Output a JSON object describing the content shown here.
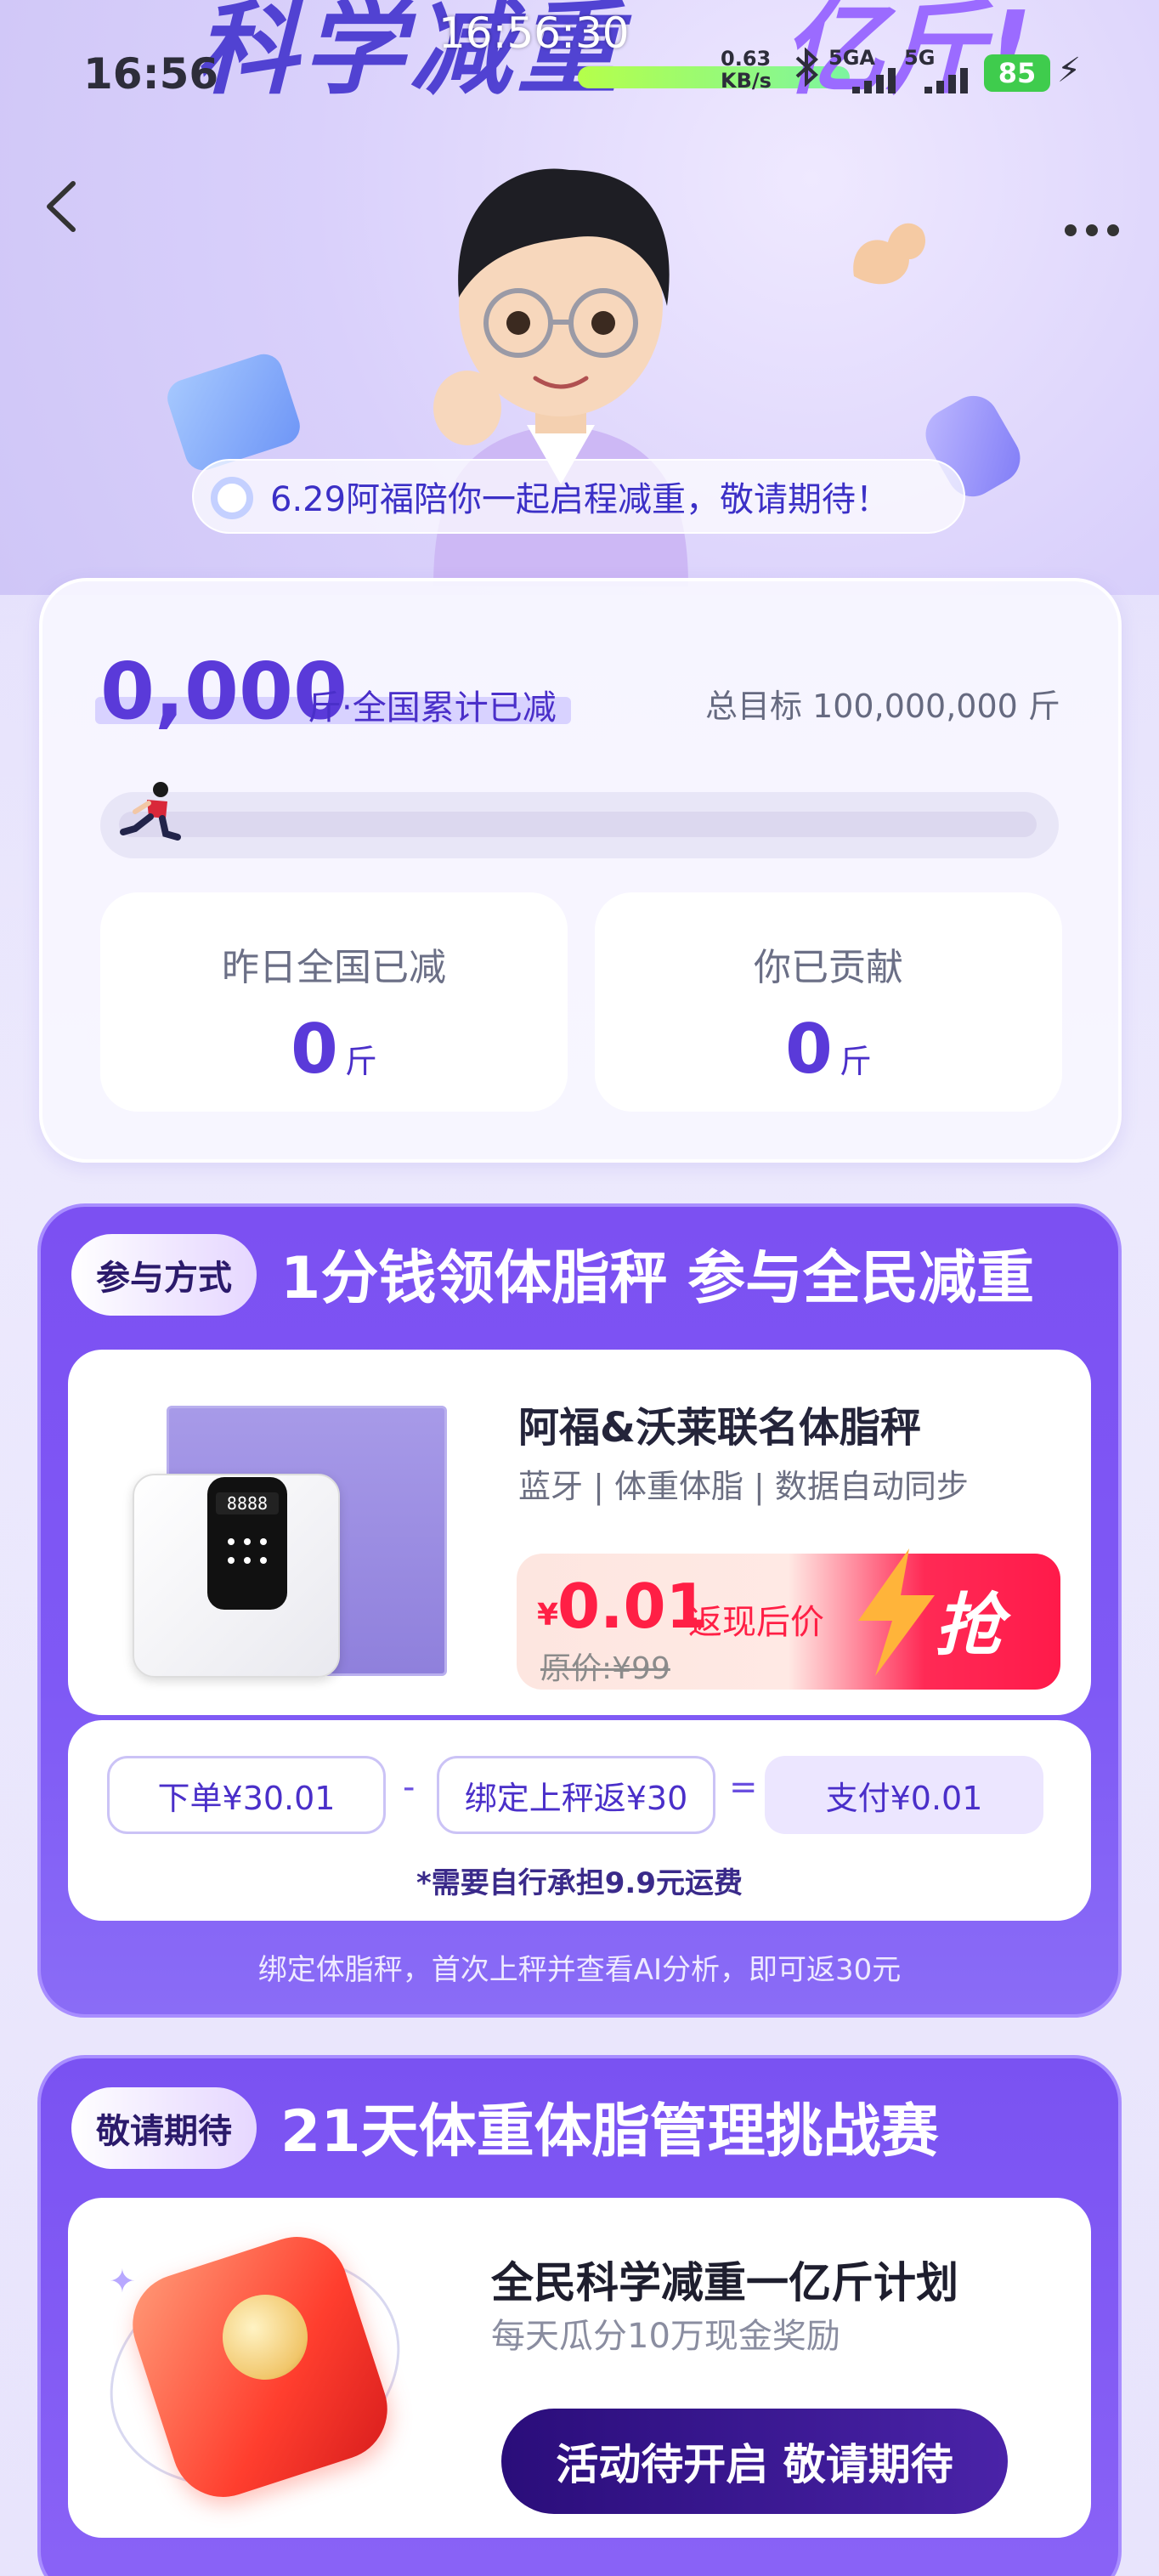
{
  "status_bar": {
    "time": "16:56",
    "clock_overlay": "16:56:30",
    "net_speed_value": "0.63",
    "net_speed_unit": "KB/s",
    "net_type_1": "5GA",
    "net_type_2": "5G",
    "battery": "85"
  },
  "hero": {
    "title_part1": "科学减重",
    "title_part2": "亿斤!",
    "notice": "6.29阿福陪你一起启程减重，敬请期待！"
  },
  "stats": {
    "total": "0,000",
    "total_unit": "斤·全国累计已减",
    "goal_label": "总目标 100,000,000 斤",
    "progress": 0,
    "yesterday_label": "昨日全国已减",
    "yesterday_value": "0",
    "contrib_label": "你已贡献",
    "contrib_value": "0",
    "unit": "斤"
  },
  "join": {
    "tag": "参与方式",
    "title": "1分钱领体脂秤 参与全民减重",
    "product_name": "阿福&沃莱联名体脂秤",
    "product_desc": "蓝牙 | 体重体脂 | 数据自动同步",
    "price_symbol": "¥",
    "price": "0.01",
    "price_note": "返现后价",
    "original_price": "原价:¥99",
    "grab_label": "抢",
    "formula": {
      "order": "下单¥30.01",
      "minus": "-",
      "bind": "绑定上秤返¥30",
      "equals": "=",
      "pay": "支付¥0.01"
    },
    "shipping_note": "*需要自行承担9.9元运费",
    "rebate_note": "绑定体脂秤，首次上秤并查看AI分析，即可返30元"
  },
  "challenge": {
    "tag": "敬请期待",
    "title": "21天体重体脂管理挑战赛",
    "card_title": "全民科学减重一亿斤计划",
    "card_sub": "每天瓜分10万现金奖励",
    "button": "活动待开启 敬请期待"
  },
  "colors": {
    "primary": "#5a3ad9",
    "section_bg": "#7c50f2",
    "price_red": "#ff1f45",
    "battery_green": "#3fcc4d"
  },
  "icons": [
    "back-icon",
    "more-icon",
    "bluetooth-icon",
    "signal-icon",
    "battery-icon",
    "charging-icon",
    "runner-icon",
    "arm-icon",
    "lightning-icon",
    "coin-icon"
  ]
}
